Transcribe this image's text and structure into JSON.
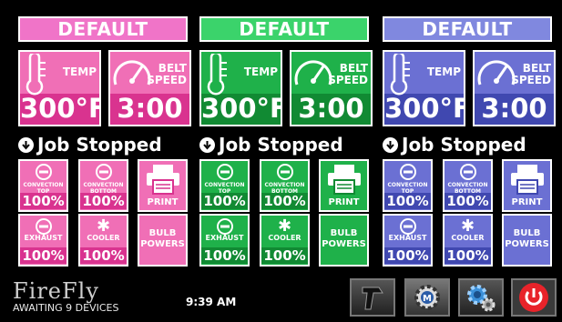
{
  "panels": [
    {
      "header": "DEFAULT",
      "colors": {
        "header": "#f074c8",
        "tile": "#f06fb6",
        "tile_dark": "#d9338f",
        "light": "#fad7ea"
      },
      "temp": {
        "label": "TEMP",
        "value": "300°F"
      },
      "belt": {
        "label1": "BELT",
        "label2": "SPEED",
        "value": "3:00"
      },
      "status": "Job Stopped",
      "convection_top": {
        "line1": "CONVECTION",
        "line2": "TOP",
        "value": "100%"
      },
      "convection_bottom": {
        "line1": "CONVECTION",
        "line2": "BOTTOM",
        "value": "100%"
      },
      "print": "PRINT",
      "exhaust": {
        "label": "EXHAUST",
        "value": "100%"
      },
      "cooler": {
        "label": "COOLER",
        "value": "100%"
      },
      "bulb": {
        "line1": "BULB",
        "line2": "POWERS"
      }
    },
    {
      "header": "DEFAULT",
      "colors": {
        "header": "#3bd36b",
        "tile": "#1fb14a",
        "tile_dark": "#118a33",
        "light": "#c9f1d5"
      },
      "temp": {
        "label": "TEMP",
        "value": "300°F"
      },
      "belt": {
        "label1": "BELT",
        "label2": "SPEED",
        "value": "3:00"
      },
      "status": "Job Stopped",
      "convection_top": {
        "line1": "CONVECTION",
        "line2": "TOP",
        "value": "100%"
      },
      "convection_bottom": {
        "line1": "CONVECTION",
        "line2": "BOTTOM",
        "value": "100%"
      },
      "print": "PRINT",
      "exhaust": {
        "label": "EXHAUST",
        "value": "100%"
      },
      "cooler": {
        "label": "COOLER",
        "value": "100%"
      },
      "bulb": {
        "line1": "BULB",
        "line2": "POWERS"
      }
    },
    {
      "header": "DEFAULT",
      "colors": {
        "header": "#8088df",
        "tile": "#6b70d3",
        "tile_dark": "#4048b0",
        "light": "#dcdff7"
      },
      "temp": {
        "label": "TEMP",
        "value": "300°F"
      },
      "belt": {
        "label1": "BELT",
        "label2": "SPEED",
        "value": "3:00"
      },
      "status": "Job Stopped",
      "convection_top": {
        "line1": "CONVECTION",
        "line2": "TOP",
        "value": "100%"
      },
      "convection_bottom": {
        "line1": "CONVECTION",
        "line2": "BOTTOM",
        "value": "100%"
      },
      "print": "PRINT",
      "exhaust": {
        "label": "EXHAUST",
        "value": "100%"
      },
      "cooler": {
        "label": "COOLER",
        "value": "100%"
      },
      "bulb": {
        "line1": "BULB",
        "line2": "POWERS"
      }
    }
  ],
  "footer": {
    "brand": "FireFly",
    "device_status": "AWAITING 9 DEVICES",
    "time": "9:39 AM",
    "icons": [
      "scanner-icon",
      "maintenance-icon",
      "settings-icon",
      "power-icon"
    ]
  }
}
